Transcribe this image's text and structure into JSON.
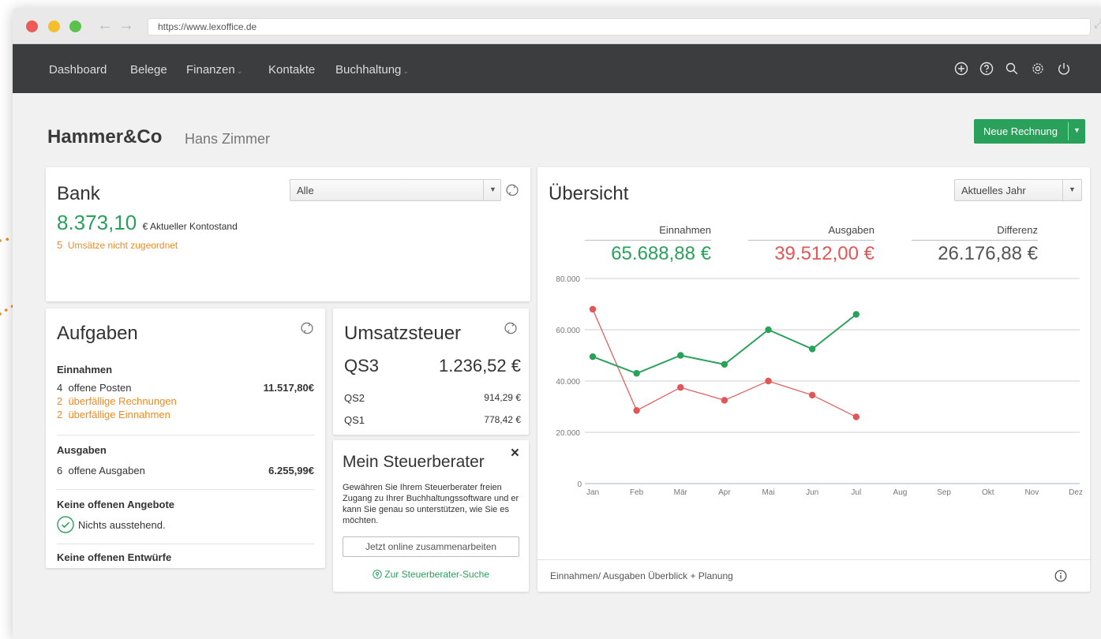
{
  "browser": {
    "url": "https://www.lexoffice.de"
  },
  "nav": {
    "items": [
      {
        "label": "Dashboard",
        "dropdown": false
      },
      {
        "label": "Belege",
        "dropdown": false
      },
      {
        "label": "Finanzen",
        "dropdown": true
      },
      {
        "label": "Kontakte",
        "dropdown": false
      },
      {
        "label": "Buchhaltung",
        "dropdown": true
      }
    ],
    "icons": [
      "plus-circle-icon",
      "help-icon",
      "search-icon",
      "gear-icon",
      "power-icon"
    ]
  },
  "header": {
    "company": "Hammer&Co",
    "person": "Hans Zimmer",
    "new_invoice_label": "Neue Rechnung"
  },
  "bank": {
    "title": "Bank",
    "filter": "Alle",
    "balance": "8.373,10",
    "balance_suffix": "€ Aktueller Kontostand",
    "unassigned_count": "5",
    "unassigned_label": "Umsätze nicht zugeordnet"
  },
  "tasks": {
    "title": "Aufgaben",
    "income_heading": "Einnahmen",
    "open_items_count": "4",
    "open_items_label": "offene Posten",
    "open_items_amount": "11.517,80€",
    "overdue_invoices": "2  überfällige Rechnungen",
    "overdue_income": "2  überfällige Einnahmen",
    "expenses_heading": "Ausgaben",
    "open_expenses_count": "6",
    "open_expenses_label": "offene Ausgaben",
    "open_expenses_amount": "6.255,99€",
    "no_offers": "Keine offenen Angebote",
    "nothing_pending": "Nichts ausstehend.",
    "no_drafts": "Keine offenen Entwürfe"
  },
  "vat": {
    "title": "Umsatzsteuer",
    "rows": [
      {
        "label": "QS3",
        "value": "1.236,52 €"
      },
      {
        "label": "QS2",
        "value": "914,29 €"
      },
      {
        "label": "QS1",
        "value": "778,42 €"
      }
    ]
  },
  "advisor": {
    "title": "Mein Steuerberater",
    "close": "×",
    "text": "Gewähren Sie Ihrem Steuerberater freien Zugang zu Ihrer Buchhaltungssoftware und er kann Sie genau so unterstützen, wie Sie es möchten.",
    "button": "Jetzt online zusammenarbeiten",
    "link": "Zur Steuerberater-Suche"
  },
  "overview": {
    "title": "Übersicht",
    "period": "Aktuelles Jahr",
    "income_label": "Einnahmen",
    "income_value": "65.688,88 €",
    "expenses_label": "Ausgaben",
    "expenses_value": "39.512,00 €",
    "diff_label": "Differenz",
    "diff_value": "26.176,88 €",
    "footer": "Einnahmen/ Ausgaben Überblick + Planung"
  },
  "colors": {
    "green": "#2aa15b",
    "red": "#e15656",
    "orange": "#f08a1d",
    "nav_bg": "#3b3d3e"
  },
  "chart_data": {
    "type": "line",
    "categories": [
      "Jan",
      "Feb",
      "Mär",
      "Apr",
      "Mai",
      "Jun",
      "Jul",
      "Aug",
      "Sep",
      "Okt",
      "Nov",
      "Dez"
    ],
    "yticks": [
      "0",
      "20.000",
      "40.000",
      "60.000",
      "80.000"
    ],
    "ylim": [
      0,
      80000
    ],
    "grid": true,
    "series": [
      {
        "color": "#2aa15b",
        "values": [
          49500,
          43000,
          50000,
          46500,
          60000,
          52500,
          66000
        ]
      },
      {
        "color": "#e15656",
        "values": [
          68000,
          28500,
          37500,
          32500,
          40000,
          34500,
          26000
        ]
      }
    ]
  }
}
